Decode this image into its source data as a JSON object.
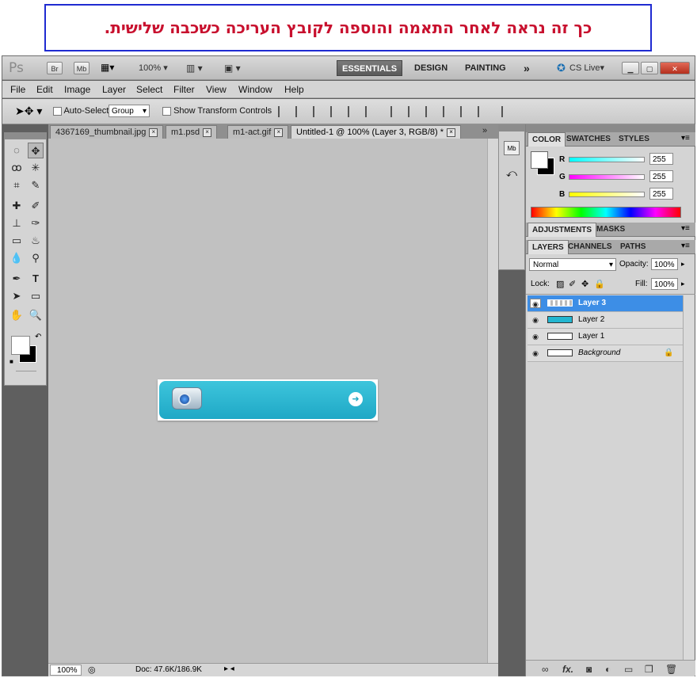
{
  "caption": "כך זה נראה לאחר התאמה והוספה לקובץ העריכה כשכבה שלישית.",
  "app": {
    "logo": "Ps",
    "br": "Br",
    "mb": "Mb",
    "zoom": "100%",
    "workspaces": [
      "ESSENTIALS",
      "DESIGN",
      "PAINTING"
    ],
    "more": "»",
    "cs_live": "CS Live▾"
  },
  "menu": [
    "File",
    "Edit",
    "Image",
    "Layer",
    "Select",
    "Filter",
    "View",
    "Window",
    "Help"
  ],
  "options": {
    "auto_select": "Auto-Select:",
    "group_value": "Group",
    "transform": "Show Transform Controls"
  },
  "tabs": [
    {
      "label": "4367169_thumbnail.jpg"
    },
    {
      "label": "m1.psd"
    },
    {
      "label": "m1-act.gif"
    },
    {
      "label": "Untitled-1 @ 100% (Layer 3, RGB/8) *"
    }
  ],
  "status": {
    "zoom": "100%",
    "doc": "Doc: 47.6K/186.9K"
  },
  "color_panel": {
    "tabs": [
      "COLOR",
      "SWATCHES",
      "STYLES"
    ],
    "channels": [
      {
        "label": "R",
        "value": "255"
      },
      {
        "label": "G",
        "value": "255"
      },
      {
        "label": "B",
        "value": "255"
      }
    ]
  },
  "adjust_panel": {
    "tabs": [
      "ADJUSTMENTS",
      "MASKS"
    ]
  },
  "layers_panel": {
    "tabs": [
      "LAYERS",
      "CHANNELS",
      "PATHS"
    ],
    "blend_mode": "Normal",
    "opacity_label": "Opacity:",
    "opacity_value": "100%",
    "lock_label": "Lock:",
    "fill_label": "Fill:",
    "fill_value": "100%",
    "layers": [
      {
        "name": "Layer 3"
      },
      {
        "name": "Layer 2"
      },
      {
        "name": "Layer 1"
      },
      {
        "name": "Background"
      }
    ],
    "footer_fx": "fx."
  },
  "colors": {
    "accent": "#3d8ee6",
    "caption_text": "#c8102e",
    "caption_border": "#1f2bd1",
    "banner": "#23b6d0",
    "arrow": "#1f2bd1"
  }
}
